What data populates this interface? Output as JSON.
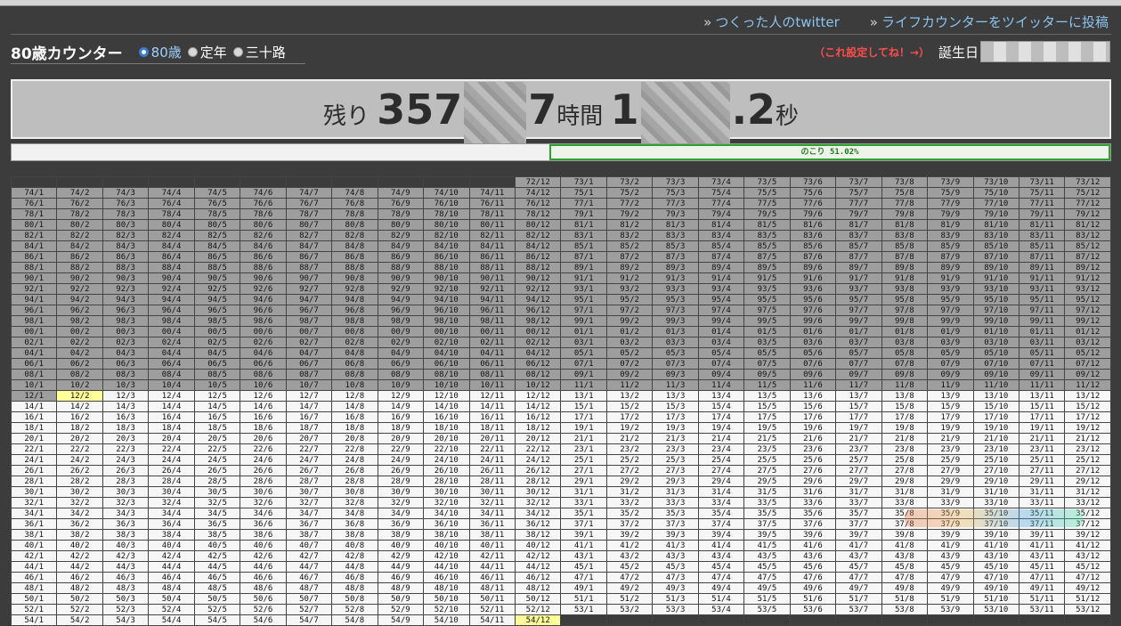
{
  "header": {
    "links": [
      {
        "chevron": "»",
        "label": "つくった人のtwitter"
      },
      {
        "chevron": "»",
        "label": "ライフカウンターをツイッターに投稿"
      }
    ]
  },
  "app": {
    "title": "80歳カウンター",
    "modes": [
      {
        "label": "80歳",
        "selected": true
      },
      {
        "label": "定年",
        "selected": false
      },
      {
        "label": "三十路",
        "selected": false
      }
    ]
  },
  "birthday": {
    "hint": "（これ設定してね！→）",
    "label": "誕生日",
    "value_redacted": true
  },
  "remaining": {
    "prefix": "残り",
    "hours_visible_start": "357",
    "hours_visible_end": "7",
    "hours_unit": "時間",
    "seconds_visible_start": "1",
    "seconds_visible_end": ".2",
    "seconds_unit": "秒"
  },
  "progress": {
    "label": "のこり 51.02%",
    "remaining_fraction": 0.5102
  },
  "calendar": {
    "first_row_start_month": 12,
    "first_year": 72,
    "rows": 41,
    "today": "12/2",
    "last_visible_marker": "52/12",
    "colors": {
      "past": "#9e9e9e",
      "future": "#f6f6f6",
      "today": "#ffff99"
    }
  },
  "colors": {
    "accent_link": "#8cc3ee",
    "hint_red": "#ff4d4d",
    "progress_green": "#2fa12f"
  }
}
